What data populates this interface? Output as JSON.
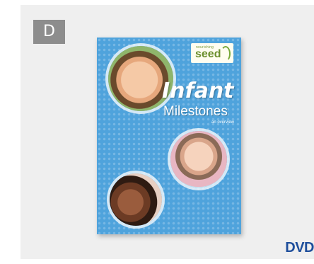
{
  "badge": {
    "label": "D"
  },
  "cover": {
    "logo_small": "nourishing",
    "logo_big": "seed",
    "title_line1": "Infant",
    "title_line2": "Milestones",
    "subtitle": "an overview"
  },
  "format_label": "DVD",
  "colors": {
    "card_bg": "#efefef",
    "badge_bg": "#8d8d8d",
    "cover_blue": "#4fa3dc",
    "dvd_blue": "#1f4f9c"
  }
}
